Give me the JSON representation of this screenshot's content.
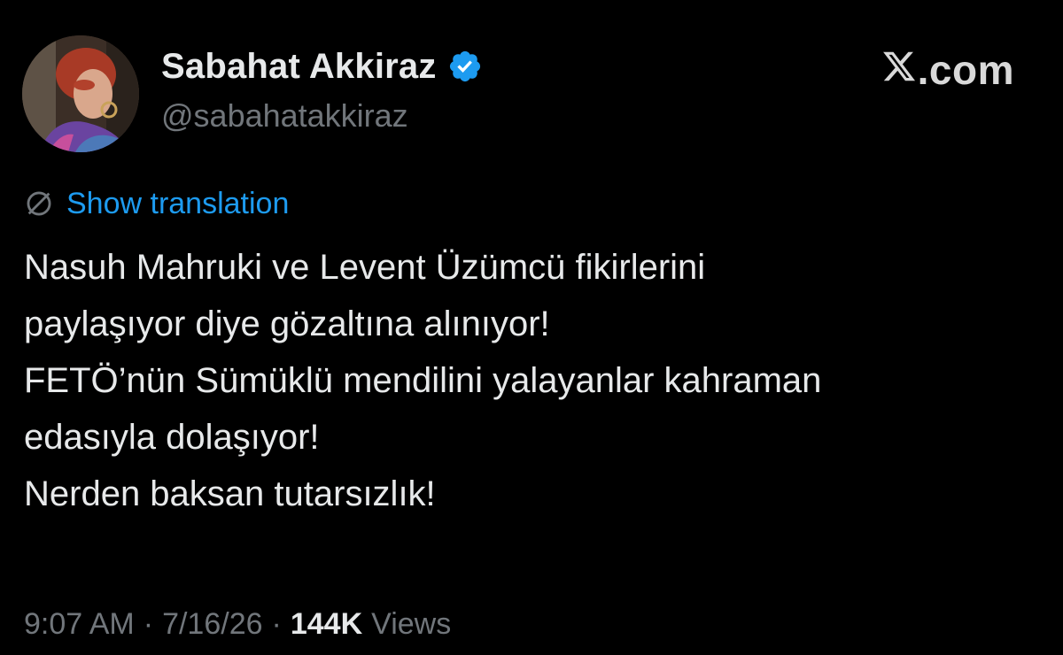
{
  "author": {
    "display_name": "Sabahat Akkiraz",
    "handle": "@sabahatakkiraz",
    "verified": true,
    "avatar_icon": "profile-photo"
  },
  "brand": {
    "site_label": ".com",
    "logo_icon": "x-logo-icon"
  },
  "translation": {
    "link_label": "Show translation",
    "icon": "globe-translate-icon"
  },
  "tweet": {
    "lines": [
      "Nasuh Mahruki ve Levent Üzümcü fikirlerini",
      "paylaşıyor diye gözaltına alınıyor!",
      "FETÖ’nün Sümüklü mendilini yalayanlar kahraman",
      "edasıyla dolaşıyor!",
      "Nerden baksan tutarsızlık!"
    ]
  },
  "meta": {
    "time": "9:07 AM",
    "separator": "·",
    "date": "7/16/26",
    "views_count": "144K",
    "views_label": "Views"
  },
  "colors": {
    "background": "#000000",
    "text_primary": "#e7e9ea",
    "text_secondary": "#71767b",
    "link": "#1d9bf0",
    "verified_badge": "#1d9bf0"
  }
}
